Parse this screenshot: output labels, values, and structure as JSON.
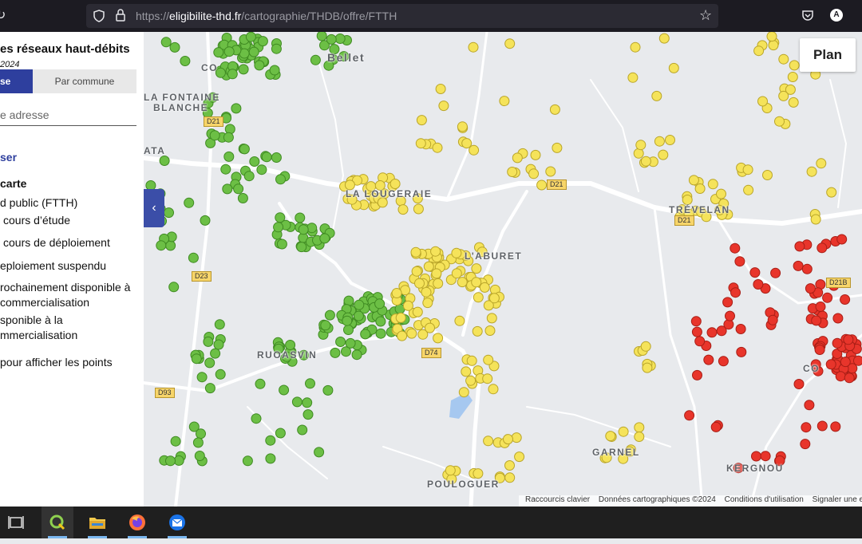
{
  "browser": {
    "url_prefix": "https://",
    "url_domain": "eligibilite-thd.fr",
    "url_path": "/cartographie/THDB/offre/FTTH",
    "avatar_letter": "A"
  },
  "panel": {
    "title": "es réseaux haut-débits",
    "date": "2024",
    "tabs": [
      "se",
      "Par commune"
    ],
    "search_placeholder": "e adresse",
    "link": "ser",
    "section_title": "carte",
    "network_label": "d public (FTTH)",
    "legend": [
      {
        "label": "cours d’étude"
      },
      {
        "label": "cours de déploiement"
      },
      {
        "label": "eploiement suspendu"
      },
      {
        "label": "rochainement disponible à",
        "label2": "commercialisation"
      },
      {
        "label": "sponible à la",
        "label2": "mmercialisation"
      }
    ],
    "hint": "pour afficher les points"
  },
  "map": {
    "colors": {
      "green": "#6cbf45",
      "yellow": "#f5e35a",
      "red": "#e8352b",
      "road": "#ffffff",
      "water": "#a6c8f0",
      "background": "#e8eaed"
    },
    "places": [
      "Bellet",
      "CO",
      "LA FONTAINE",
      "BLANCHE",
      "ATA",
      "LA LOUGERAIE",
      "L'ABURET",
      "TRÉVELAN",
      "RUOASVIN",
      "GARNEL",
      "POULOGUER",
      "KERGNOU",
      "CO"
    ],
    "roads": [
      "D21",
      "D21",
      "D21",
      "D23",
      "D74",
      "D93",
      "D21B"
    ],
    "plan_button": "Plan",
    "attribution": [
      "Raccourcis clavier",
      "Données cartographiques ©2024",
      "Conditions d'utilisation",
      "Signaler une e"
    ]
  }
}
